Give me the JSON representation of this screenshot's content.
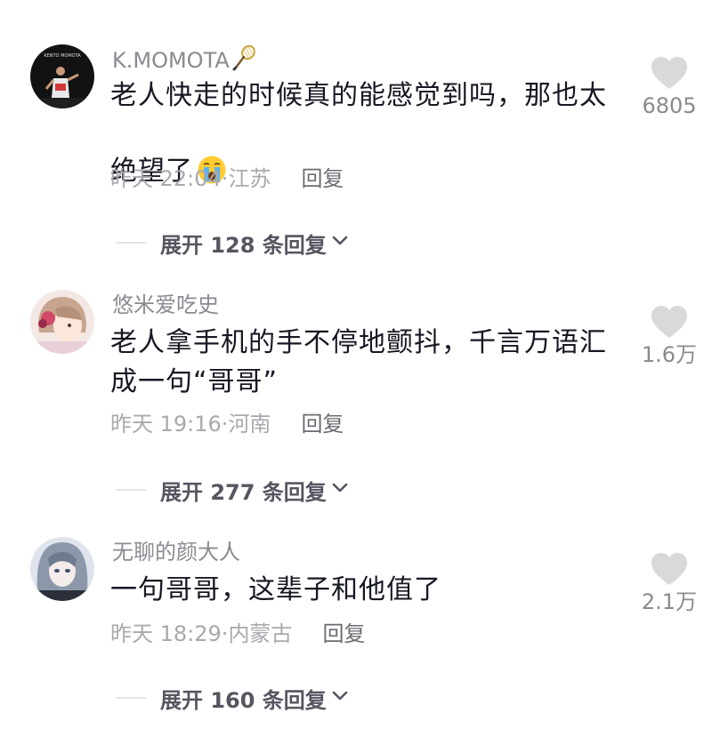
{
  "comments": [
    {
      "username": "K.MOMOTA",
      "username_icon": "badminton-racket-icon",
      "text": "老人快走的时候真的能感觉到吗，那也太\n绝望了",
      "text_emoji": "crying-face-emoji",
      "time": "昨天 22:04",
      "location": "江苏",
      "reply_label": "回复",
      "likes": "6805",
      "expand_label": "展开 128 条回复",
      "avatar_caption": "KENTO MOMOTA"
    },
    {
      "username": "悠米爱吃史",
      "text": "老人拿手机的手不停地颤抖，千言万语汇\n成一句“哥哥”",
      "time": "昨天 19:16",
      "location": "河南",
      "reply_label": "回复",
      "likes": "1.6万",
      "expand_label": "展开 277 条回复"
    },
    {
      "username": "无聊的颜大人",
      "text": "一句哥哥，这辈子和他值了",
      "time": "昨天 18:29",
      "location": "内蒙古",
      "reply_label": "回复",
      "likes": "2.1万",
      "expand_label": "展开 160 条回复"
    }
  ],
  "separator": "·",
  "colors": {
    "text_primary": "#161823",
    "username": "#8a8b91",
    "meta": "#a8a9ae",
    "reply": "#6b6c72",
    "heart": "#d9d9dc",
    "expand": "#555660"
  }
}
